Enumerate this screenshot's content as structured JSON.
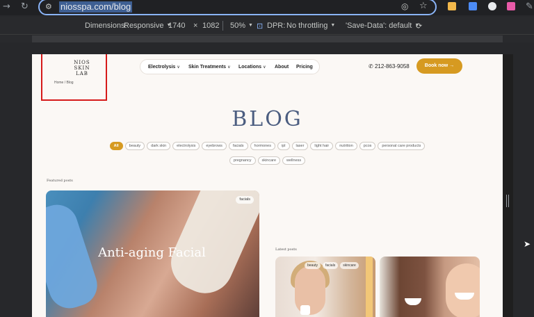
{
  "browser": {
    "url": "niosspa.com/blog"
  },
  "devtools": {
    "dimensions_label": "Dimensions:",
    "dimensions_mode": "Responsive",
    "width": "1740",
    "times": "×",
    "height": "1082",
    "zoom": "50%",
    "dpr_label": "DPR:",
    "throttling": "No throttling",
    "save_data": "'Save-Data': default"
  },
  "site": {
    "logo_lines": [
      "NIOS",
      "SKIN",
      "LAB"
    ],
    "breadcrumb": "Home / Blog",
    "nav": [
      {
        "label": "Electrolysis",
        "dropdown": true
      },
      {
        "label": "Skin Treatments",
        "dropdown": true
      },
      {
        "label": "Locations",
        "dropdown": true
      },
      {
        "label": "About",
        "dropdown": false
      },
      {
        "label": "Pricing",
        "dropdown": false
      }
    ],
    "phone": "212-863-9058",
    "book_label": "Book now",
    "title": "BLOG",
    "tags_row1": [
      "All",
      "beauty",
      "dark skin",
      "electrolysis",
      "eyebrows",
      "facials",
      "hormones",
      "ipl",
      "laser",
      "light hair",
      "nutrition",
      "pcos",
      "personal care products"
    ],
    "tags_row2": [
      "pregnancy",
      "skincare",
      "wellness"
    ],
    "featured_label": "Featured posts",
    "featured": {
      "tag": "facials",
      "title": "Anti-aging Facial"
    },
    "latest_label": "Latest posts",
    "latest": [
      {
        "tags": [
          "beauty",
          "facials",
          "skincare"
        ]
      },
      {
        "tags": []
      }
    ]
  },
  "colors": {
    "accent": "#d69a21",
    "title": "#4b5d80",
    "background": "#fbf8f5"
  }
}
